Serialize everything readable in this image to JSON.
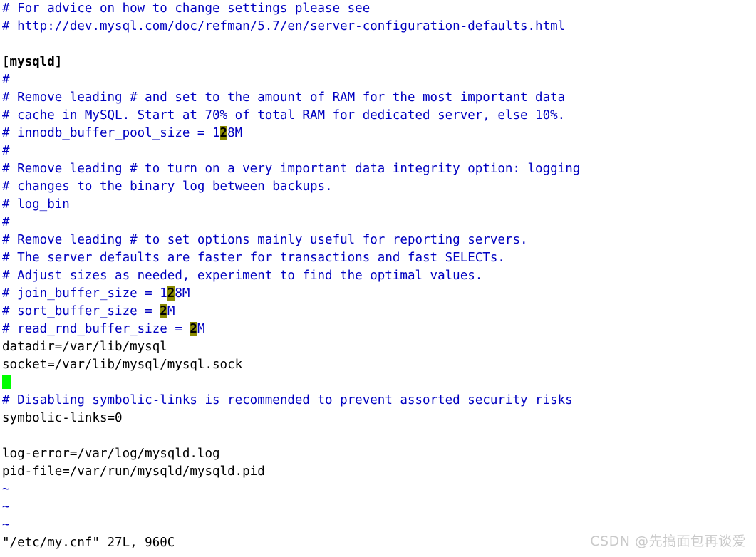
{
  "editor": {
    "app": "vim",
    "filename": "/etc/my.cnf",
    "colors": {
      "background": "#ffffff",
      "comment": "#0000c0",
      "normal_text": "#000000",
      "search_highlight_bg": "#8a8a00",
      "search_highlight_fg": "#000000",
      "cursor": "#00ff00",
      "tilde": "#0000c0",
      "watermark": "#c9c9c9"
    },
    "lines": [
      {
        "id": "l1",
        "kind": "comment",
        "text": "# For advice on how to change settings please see"
      },
      {
        "id": "l2",
        "kind": "comment",
        "text": "# http://dev.mysql.com/doc/refman/5.7/en/server-configuration-defaults.html"
      },
      {
        "id": "l3",
        "kind": "blank",
        "text": ""
      },
      {
        "id": "l4",
        "kind": "section",
        "text": "[mysqld]"
      },
      {
        "id": "l5",
        "kind": "comment",
        "text": "#"
      },
      {
        "id": "l6",
        "kind": "comment",
        "text": "# Remove leading # and set to the amount of RAM for the most important data"
      },
      {
        "id": "l7",
        "kind": "comment",
        "text": "# cache in MySQL. Start at 70% of total RAM for dedicated server, else 10%."
      },
      {
        "id": "l8",
        "kind": "comment-hl",
        "pre": "# innodb_buffer_pool_size = 1",
        "hl": "2",
        "post": "8M"
      },
      {
        "id": "l9",
        "kind": "comment",
        "text": "#"
      },
      {
        "id": "l10",
        "kind": "comment",
        "text": "# Remove leading # to turn on a very important data integrity option: logging"
      },
      {
        "id": "l11",
        "kind": "comment",
        "text": "# changes to the binary log between backups."
      },
      {
        "id": "l12",
        "kind": "comment",
        "text": "# log_bin"
      },
      {
        "id": "l13",
        "kind": "comment",
        "text": "#"
      },
      {
        "id": "l14",
        "kind": "comment",
        "text": "# Remove leading # to set options mainly useful for reporting servers."
      },
      {
        "id": "l15",
        "kind": "comment",
        "text": "# The server defaults are faster for transactions and fast SELECTs."
      },
      {
        "id": "l16",
        "kind": "comment",
        "text": "# Adjust sizes as needed, experiment to find the optimal values."
      },
      {
        "id": "l17",
        "kind": "comment-hl",
        "pre": "# join_buffer_size = 1",
        "hl": "2",
        "post": "8M"
      },
      {
        "id": "l18",
        "kind": "comment-hl",
        "pre": "# sort_buffer_size = ",
        "hl": "2",
        "post": "M"
      },
      {
        "id": "l19",
        "kind": "comment-hl",
        "pre": "# read_rnd_buffer_size = ",
        "hl": "2",
        "post": "M"
      },
      {
        "id": "l20",
        "kind": "normal",
        "text": "datadir=/var/lib/mysql"
      },
      {
        "id": "l21",
        "kind": "normal",
        "text": "socket=/var/lib/mysql/mysql.sock"
      },
      {
        "id": "l22",
        "kind": "cursor",
        "text": ""
      },
      {
        "id": "l23",
        "kind": "comment",
        "text": "# Disabling symbolic-links is recommended to prevent assorted security risks"
      },
      {
        "id": "l24",
        "kind": "normal",
        "text": "symbolic-links=0"
      },
      {
        "id": "l25",
        "kind": "blank",
        "text": ""
      },
      {
        "id": "l26",
        "kind": "normal",
        "text": "log-error=/var/log/mysqld.log"
      },
      {
        "id": "l27",
        "kind": "normal",
        "text": "pid-file=/var/run/mysqld/mysqld.pid"
      },
      {
        "id": "t1",
        "kind": "tilde",
        "text": "~"
      },
      {
        "id": "t2",
        "kind": "tilde",
        "text": "~"
      },
      {
        "id": "t3",
        "kind": "tilde",
        "text": "~"
      }
    ],
    "status_line": "\"/etc/my.cnf\" 27L, 960C",
    "file_stats": {
      "lines": "27L",
      "chars": "960C"
    }
  },
  "watermark": {
    "text": "CSDN @先搞面包再谈爱"
  }
}
